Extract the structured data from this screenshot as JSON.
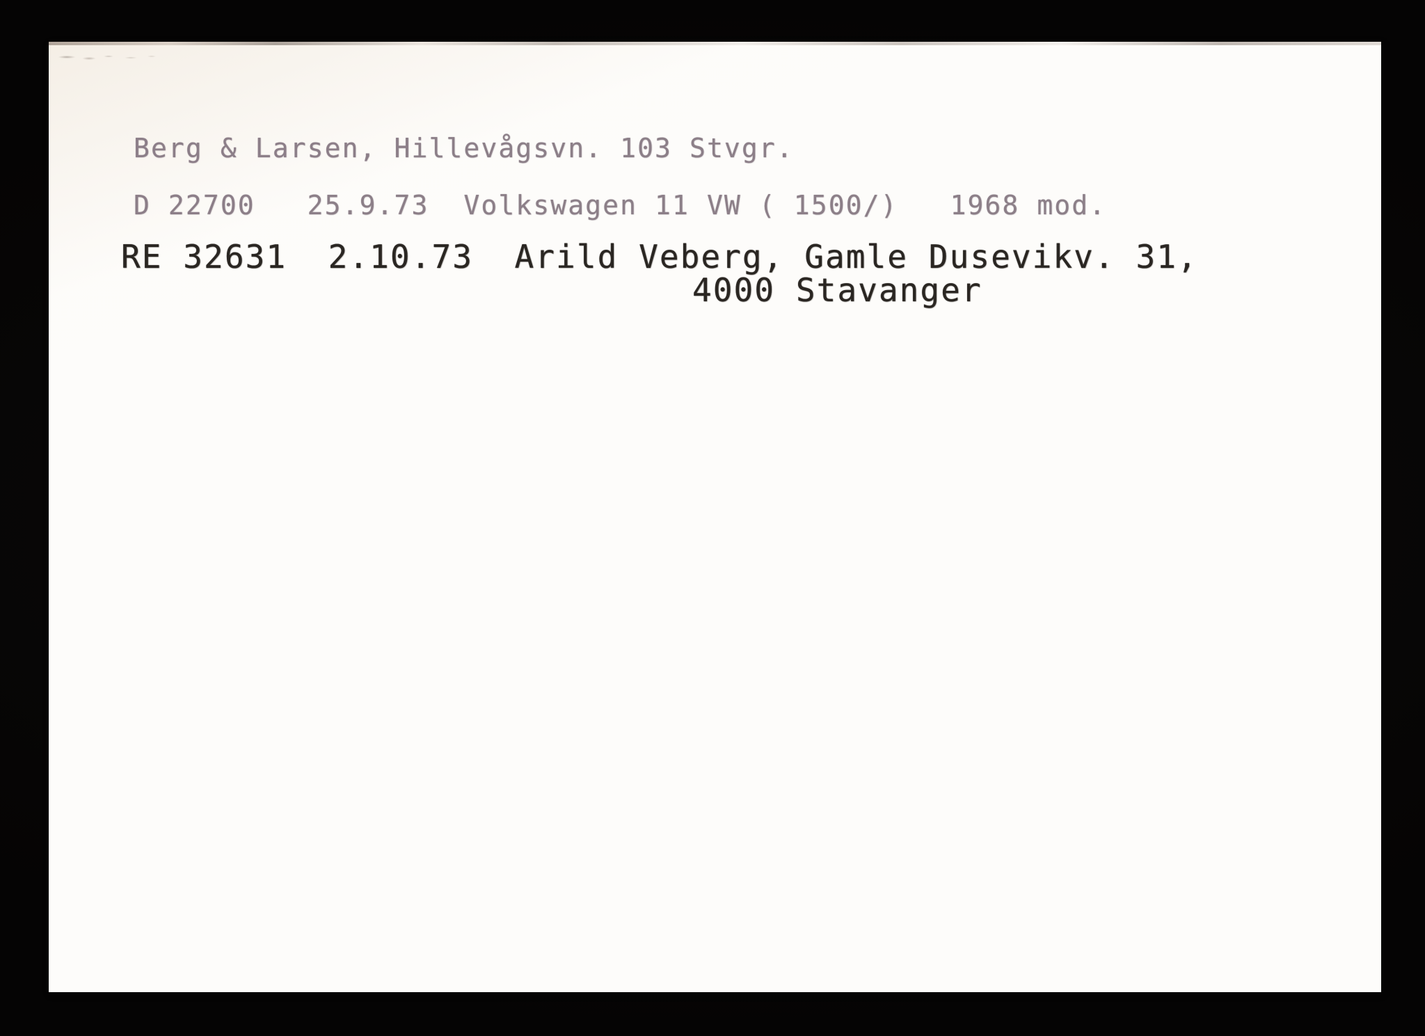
{
  "document": {
    "kind": "scanned-index-card",
    "background_color": "#080706",
    "card_color": "#fdfcfa",
    "ink_faded_color": "#897b85",
    "ink_dark_color": "#2a2622",
    "lines": {
      "company": "Berg & Larsen, Hillevågsvn. 103 Stvgr.",
      "vehicle": "D 22700   25.9.73  Volkswagen 11 VW ( 1500/)   1968 mod.",
      "owner": "RE 32631  2.10.73  Arild Veberg, Gamle Dusevikv. 31,",
      "postal": "4000 Stavanger"
    }
  }
}
